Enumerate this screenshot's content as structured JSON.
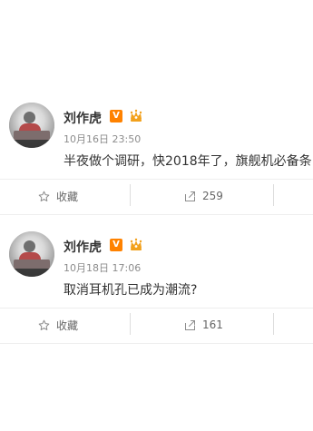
{
  "posts": [
    {
      "user": {
        "name": "刘作虎",
        "avatar_icon": "user-avatar",
        "verified_icon": "orange-v-badge",
        "crown_icon": "crown-badge",
        "verified_label": "V"
      },
      "time": "10月16日 23:50",
      "content": "半夜做个调研，快2018年了，旗舰机必备条",
      "actions": {
        "favorite_label": "收藏",
        "favorite_icon": "star-icon",
        "forward_label": "259",
        "forward_icon": "share-arrow-icon"
      }
    },
    {
      "user": {
        "name": "刘作虎",
        "avatar_icon": "user-avatar",
        "verified_icon": "orange-v-badge",
        "crown_icon": "crown-badge",
        "verified_label": "V"
      },
      "time": "10月18日 17:06",
      "content": "取消耳机孔已成为潮流?",
      "actions": {
        "favorite_label": "收藏",
        "favorite_icon": "star-icon",
        "forward_label": "161",
        "forward_icon": "share-arrow-icon"
      }
    }
  ],
  "colors": {
    "text": "#333333",
    "meta": "#8c8c8c",
    "accent": "#ff8200",
    "crown": "#f2a11d",
    "divider": "#eeeeee"
  }
}
